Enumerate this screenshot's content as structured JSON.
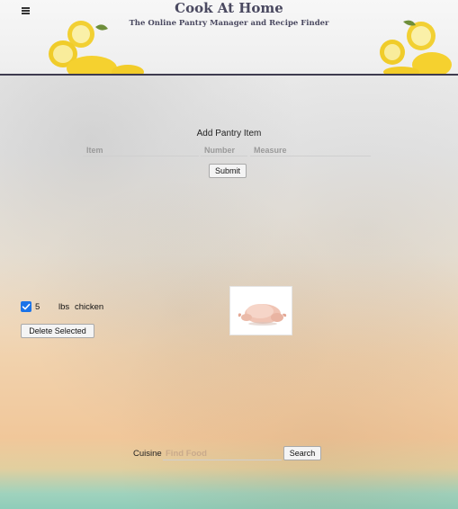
{
  "header": {
    "title": "Cook At Home",
    "subtitle": "The Online Pantry Manager and Recipe Finder",
    "menu_icon": "hamburger-menu-icon"
  },
  "add_pantry": {
    "title": "Add Pantry Item",
    "item_placeholder": "Item",
    "number_placeholder": "Number",
    "measure_placeholder": "Measure",
    "submit_label": "Submit"
  },
  "pantry": {
    "items": [
      {
        "checked": true,
        "quantity": "5",
        "measure": "lbs",
        "name": "chicken"
      }
    ],
    "delete_label": "Delete Selected"
  },
  "search": {
    "label": "Cuisine",
    "placeholder": "Find Food",
    "button_label": "Search"
  },
  "colors": {
    "header_text": "#4a4960",
    "header_border": "#3e3b4f",
    "checkbox": "#1a73e8",
    "search_placeholder": "#c9aa8b"
  }
}
